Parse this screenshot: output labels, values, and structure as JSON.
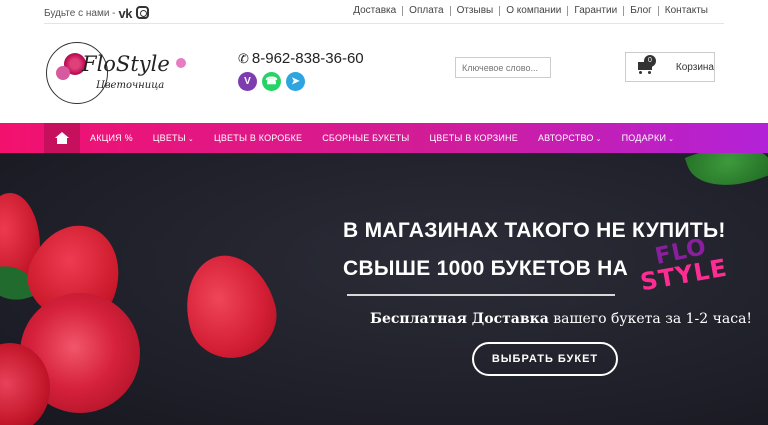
{
  "topbar": {
    "follow_text": "Будьте с нами -",
    "social": [
      "vk-icon",
      "instagram-icon"
    ],
    "links": [
      "Доставка",
      "Оплата",
      "Отзывы",
      "О компании",
      "Гарантии",
      "Блог",
      "Контакты"
    ]
  },
  "header": {
    "logo_title": "FloStyle",
    "logo_sub": "Цветочница",
    "phone": "8-962-838-36-60",
    "messengers": [
      "viber-icon",
      "whatsapp-icon",
      "telegram-icon"
    ],
    "search_placeholder": "Ключевое слово...",
    "cart_count": "0",
    "cart_label": "Корзина"
  },
  "nav": {
    "items": [
      {
        "label": "АКЦИЯ %",
        "dropdown": false
      },
      {
        "label": "ЦВЕТЫ",
        "dropdown": true
      },
      {
        "label": "ЦВЕТЫ В КОРОБКЕ",
        "dropdown": false
      },
      {
        "label": "СБОРНЫЕ БУКЕТЫ",
        "dropdown": false
      },
      {
        "label": "ЦВЕТЫ В КОРЗИНЕ",
        "dropdown": false
      },
      {
        "label": "АВТОРСТВО",
        "dropdown": true
      },
      {
        "label": "ПОДАРКИ",
        "dropdown": true
      }
    ]
  },
  "hero": {
    "line1": "В МАГАЗИНАХ ТАКОГО НЕ КУПИТЬ!",
    "line2": "СВЫШЕ 1000 БУКЕТОВ НА",
    "brand_top": "FLO",
    "brand_bottom": "STYLE",
    "sub_bold": "Бесплатная Доставка",
    "sub_rest": " вашего букета за 1-2 часа!",
    "button": "ВЫБРАТЬ БУКЕТ"
  },
  "colors": {
    "nav_gradient_start": "#f3116e",
    "nav_gradient_end": "#b322d8",
    "home_bg": "#c6105e"
  }
}
